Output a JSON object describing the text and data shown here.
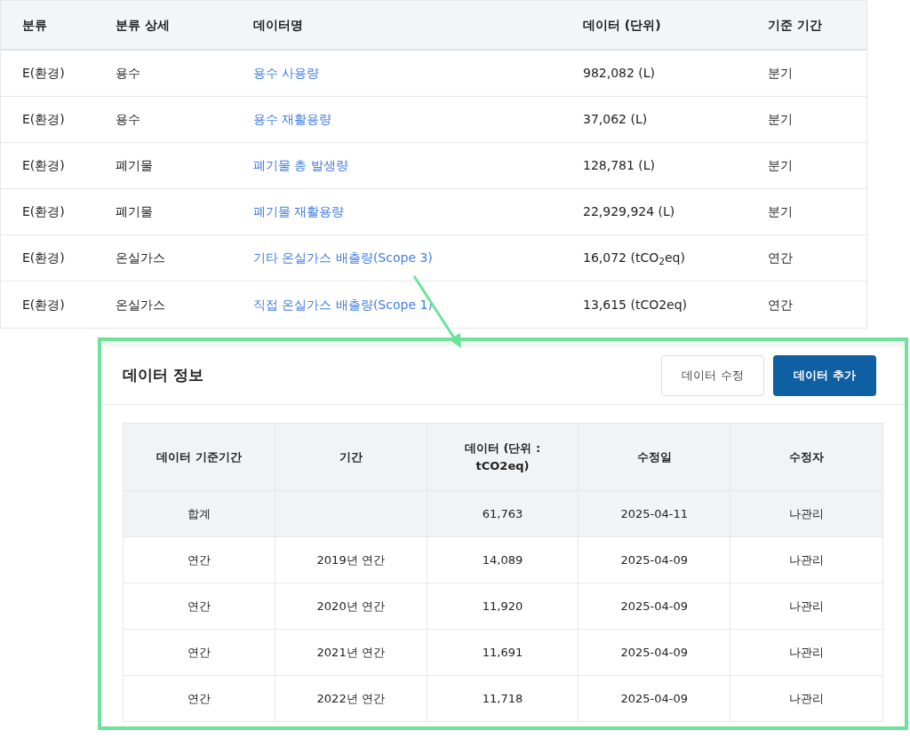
{
  "data_table": {
    "columns": [
      "분류",
      "분류 상세",
      "데이터명",
      "데이터 (단위)",
      "기준 기간"
    ],
    "rows": [
      {
        "category": "E(환경)",
        "detail": "용수",
        "name": "용수 사용량",
        "value": "982,082 (L)",
        "period": "분기"
      },
      {
        "category": "E(환경)",
        "detail": "용수",
        "name": "용수 재활용량",
        "value": "37,062 (L)",
        "period": "분기"
      },
      {
        "category": "E(환경)",
        "detail": "폐기물",
        "name": "폐기물 총 발생량",
        "value": "128,781 (L)",
        "period": "분기"
      },
      {
        "category": "E(환경)",
        "detail": "폐기물",
        "name": "폐기물 재활용량",
        "value": "22,929,924 (L)",
        "period": "분기"
      },
      {
        "category": "E(환경)",
        "detail": "온실가스",
        "name": "기타 온실가스 배출량(Scope 3)",
        "value": "16,072 (tCO$_{2}$eq)",
        "period": "연간"
      },
      {
        "category": "E(환경)",
        "detail": "온실가스",
        "name": "직접 온실가스 배출량(Scope 1)",
        "value": "13,615 (tCO2eq)",
        "period": "연간"
      }
    ]
  },
  "detail_panel": {
    "title": "데이터 정보",
    "buttons": [
      {
        "label": "데이터 수정",
        "kind": "secondary"
      },
      {
        "label": "데이터 추가",
        "kind": "primary"
      }
    ],
    "table": {
      "columns": [
        "데이터 기준기간",
        "기간",
        "데이터 (단위 : tCO2eq)",
        "수정일",
        "수정자"
      ],
      "rows": [
        {
          "kind": "total",
          "cells": [
            "합계",
            "",
            "61,763",
            "2025-04-11",
            "나관리"
          ]
        },
        {
          "kind": "normal",
          "cells": [
            "연간",
            "2019년 연간",
            "14,089",
            "2025-04-09",
            "나관리"
          ]
        },
        {
          "kind": "normal",
          "cells": [
            "연간",
            "2020년 연간",
            "11,920",
            "2025-04-09",
            "나관리"
          ]
        },
        {
          "kind": "normal",
          "cells": [
            "연간",
            "2021년 연간",
            "11,691",
            "2025-04-09",
            "나관리"
          ]
        },
        {
          "kind": "normal",
          "cells": [
            "연간",
            "2022년 연간",
            "11,718",
            "2025-04-09",
            "나관리"
          ]
        }
      ]
    }
  }
}
